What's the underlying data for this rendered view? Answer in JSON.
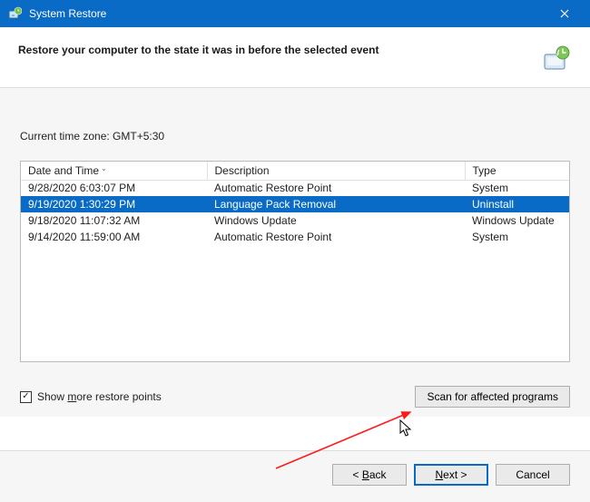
{
  "window": {
    "title": "System Restore",
    "close_icon": "close-icon"
  },
  "header": {
    "heading": "Restore your computer to the state it was in before the selected event"
  },
  "timezone_label": "Current time zone: GMT+5:30",
  "table": {
    "columns": [
      {
        "label": "Date and Time",
        "sorted": "desc"
      },
      {
        "label": "Description"
      },
      {
        "label": "Type"
      }
    ],
    "rows": [
      {
        "datetime": "9/28/2020 6:03:07 PM",
        "description": "Automatic Restore Point",
        "type": "System",
        "selected": false
      },
      {
        "datetime": "9/19/2020 1:30:29 PM",
        "description": "Language Pack Removal",
        "type": "Uninstall",
        "selected": true
      },
      {
        "datetime": "9/18/2020 11:07:32 AM",
        "description": "Windows Update",
        "type": "Windows Update",
        "selected": false
      },
      {
        "datetime": "9/14/2020 11:59:00 AM",
        "description": "Automatic Restore Point",
        "type": "System",
        "selected": false
      }
    ]
  },
  "show_more_checkbox": {
    "checked": true,
    "label_pre": "Show ",
    "label_u": "m",
    "label_post": "ore restore points"
  },
  "buttons": {
    "scan": "Scan for affected programs",
    "back_pre": "< ",
    "back_u": "B",
    "back_post": "ack",
    "next_u": "N",
    "next_post": "ext >",
    "cancel": "Cancel"
  }
}
